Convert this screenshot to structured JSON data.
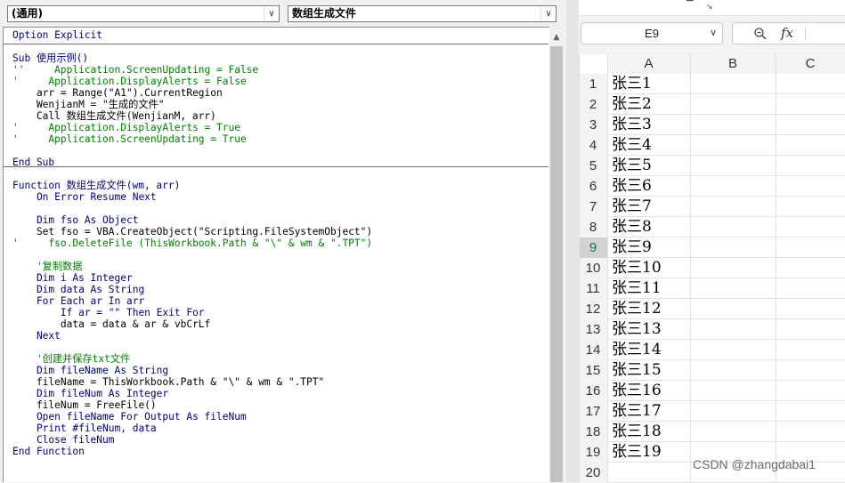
{
  "vba_editor": {
    "object_dropdown": "(通用)",
    "procedure_dropdown": "数组生成文件",
    "code_lines": [
      {
        "text": "Option Explicit",
        "color": "#00007f"
      },
      {
        "text": "",
        "color": "#000000"
      },
      {
        "text": "Sub 使用示例()",
        "color": "#00007f"
      },
      {
        "text": "''     Application.ScreenUpdating = False",
        "color": "#008000"
      },
      {
        "text": "'     Application.DisplayAlerts = False",
        "color": "#008000"
      },
      {
        "text": "    arr = Range(\"A1\").CurrentRegion",
        "color": "#000000"
      },
      {
        "text": "    WenjianM = \"生成的文件\"",
        "color": "#000000"
      },
      {
        "text": "    Call 数组生成文件(WenjianM, arr)",
        "color": "#000000"
      },
      {
        "text": "'     Application.DisplayAlerts = True",
        "color": "#008000"
      },
      {
        "text": "'     Application.ScreenUpdating = True",
        "color": "#008000"
      },
      {
        "text": "",
        "color": "#000000"
      },
      {
        "text": "End Sub",
        "color": "#00007f"
      },
      {
        "text": "",
        "color": "#000000"
      },
      {
        "text": "Function 数组生成文件(wm, arr)",
        "color": "#00007f"
      },
      {
        "text": "    On Error Resume Next",
        "color": "#00007f"
      },
      {
        "text": "",
        "color": "#000000"
      },
      {
        "text": "    Dim fso As Object",
        "color": "#00007f"
      },
      {
        "text": "    Set fso = VBA.CreateObject(\"Scripting.FileSystemObject\")",
        "color": "#000000"
      },
      {
        "text": "'     fso.DeleteFile (ThisWorkbook.Path & \"\\\" & wm & \".TPT\")",
        "color": "#008000"
      },
      {
        "text": "",
        "color": "#000000"
      },
      {
        "text": "    '复制数据",
        "color": "#008000"
      },
      {
        "text": "    Dim i As Integer",
        "color": "#00007f"
      },
      {
        "text": "    Dim data As String",
        "color": "#00007f"
      },
      {
        "text": "    For Each ar In arr",
        "color": "#00007f"
      },
      {
        "text": "        If ar = \"\" Then Exit For",
        "color": "#00007f"
      },
      {
        "text": "        data = data & ar & vbCrLf",
        "color": "#000000"
      },
      {
        "text": "    Next",
        "color": "#00007f"
      },
      {
        "text": "",
        "color": "#000000"
      },
      {
        "text": "    '创建并保存txt文件",
        "color": "#008000"
      },
      {
        "text": "    Dim fileName As String",
        "color": "#00007f"
      },
      {
        "text": "    fileName = ThisWorkbook.Path & \"\\\" & wm & \".TPT\"",
        "color": "#000000"
      },
      {
        "text": "    Dim fileNum As Integer",
        "color": "#00007f"
      },
      {
        "text": "    fileNum = FreeFile()",
        "color": "#000000"
      },
      {
        "text": "    Open fileName For Output As fileNum",
        "color": "#00007f"
      },
      {
        "text": "    Print #fileNum, data",
        "color": "#00007f"
      },
      {
        "text": "    Close fileNum",
        "color": "#00007f"
      },
      {
        "text": "End Function",
        "color": "#00007f"
      }
    ]
  },
  "excel": {
    "name_box": "E9",
    "zoom_icon": "magnifier-icon",
    "fx_label": "fx",
    "columns": [
      "A",
      "B",
      "C"
    ],
    "row_numbers": [
      "1",
      "2",
      "3",
      "4",
      "5",
      "6",
      "7",
      "8",
      "9",
      "10",
      "11",
      "12",
      "13",
      "14",
      "15",
      "16",
      "17",
      "18",
      "19",
      "20"
    ],
    "selected_row": "9",
    "column_a_values": [
      "张三1",
      "张三2",
      "张三3",
      "张三4",
      "张三5",
      "张三6",
      "张三7",
      "张三8",
      "张三9",
      "张三10",
      "张三11",
      "张三12",
      "张三13",
      "张三14",
      "张三15",
      "张三16",
      "张三17",
      "张三18",
      "张三19"
    ]
  },
  "watermark": "CSDN @zhangdabai1"
}
